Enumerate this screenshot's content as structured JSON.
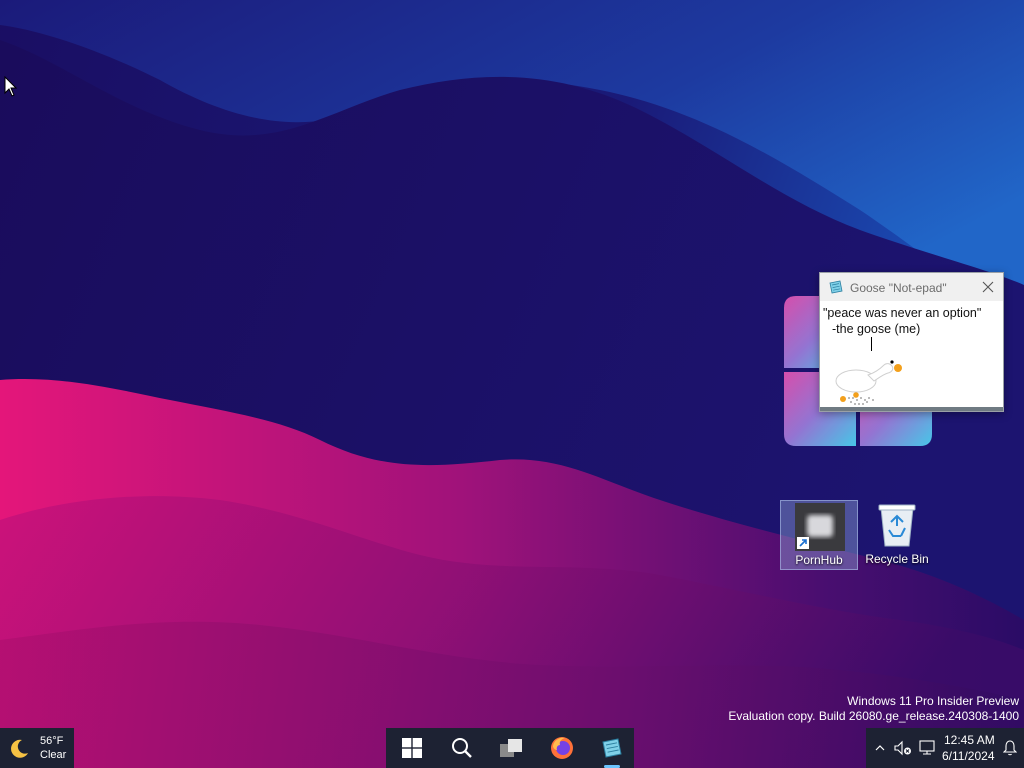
{
  "notepad": {
    "title": "Goose \"Not-epad\"",
    "lines": [
      "\"peace was never an option\"",
      "-the goose (me)"
    ]
  },
  "desktop_icons": [
    {
      "label": "PornHub",
      "icon": "blurred-shortcut-icon",
      "selected": true
    },
    {
      "label": "Recycle Bin",
      "icon": "recycle-bin-icon",
      "selected": false
    }
  ],
  "watermark": {
    "line1": "Windows 11 Pro Insider Preview",
    "line2": "Evaluation copy. Build 26080.ge_release.240308-1400"
  },
  "weather": {
    "temp": "56°F",
    "condition": "Clear",
    "icon": "moon-icon"
  },
  "taskbar_apps": [
    "start-icon",
    "search-icon",
    "task-view-icon",
    "firefox-icon",
    "notepad-app-icon"
  ],
  "clock": {
    "time": "12:45 AM",
    "date": "6/11/2024"
  },
  "tray_icons": [
    "chevron-up-icon",
    "muted-speaker-icon",
    "network-icon",
    "bell-icon"
  ],
  "colors": {
    "taskbar": "#1d2233",
    "accent": "#6cc5ff",
    "wallpaper_base": "#1a0a5e"
  }
}
